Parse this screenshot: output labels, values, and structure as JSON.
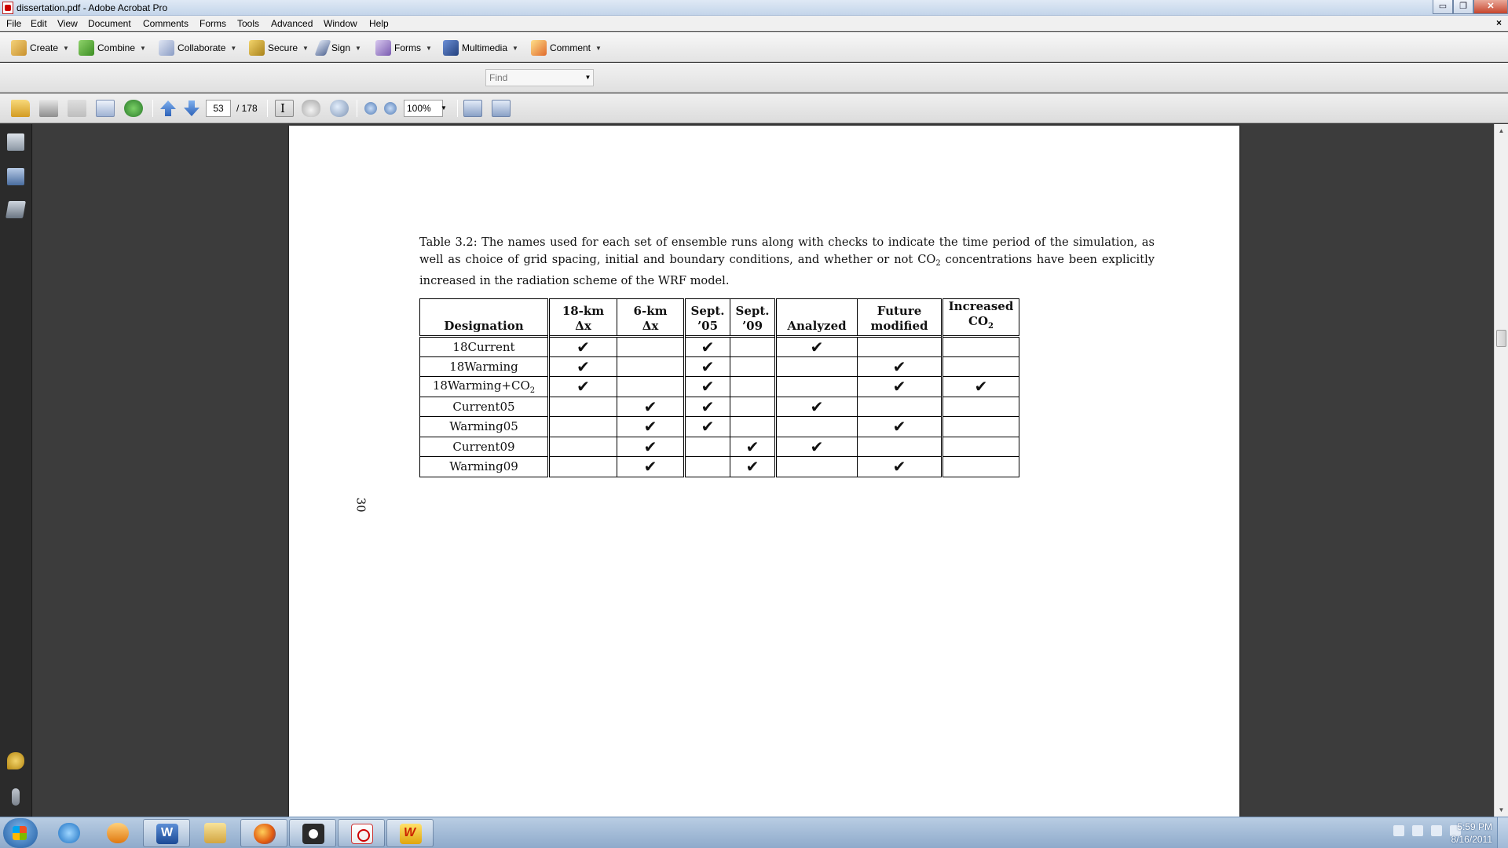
{
  "window": {
    "title": "dissertation.pdf - Adobe Acrobat Pro",
    "buttons": {
      "minimize": "▭",
      "restore": "❐",
      "close": "✕"
    }
  },
  "menu": [
    "File",
    "Edit",
    "View",
    "Document",
    "Comments",
    "Forms",
    "Tools",
    "Advanced",
    "Window",
    "Help"
  ],
  "menu_close": "×",
  "tasks": [
    {
      "label": "Create",
      "icon": "create-icon"
    },
    {
      "label": "Combine",
      "icon": "combine-icon"
    },
    {
      "label": "Collaborate",
      "icon": "collaborate-icon"
    },
    {
      "label": "Secure",
      "icon": "lock-icon"
    },
    {
      "label": "Sign",
      "icon": "pen-icon"
    },
    {
      "label": "Forms",
      "icon": "forms-icon"
    },
    {
      "label": "Multimedia",
      "icon": "multimedia-icon"
    },
    {
      "label": "Comment",
      "icon": "comment-icon"
    }
  ],
  "find": {
    "placeholder": "Find"
  },
  "nav": {
    "page_current": "53",
    "page_total": "/ 178",
    "zoom": "100%"
  },
  "document": {
    "caption_main": "Table 3.2:  The names used for each set of ensemble runs along with checks to indicate the time period of the simulation, as well as choice of grid spacing, initial and boundary conditions, and whether or not CO",
    "caption_sub": "2",
    "caption_tail": " concentrations have been explicitly increased in the radiation scheme of the WRF model.",
    "page_number": "30",
    "table": {
      "headers": {
        "designation": "Designation",
        "grid18_l1": "18-km",
        "grid18_l2": "Δx",
        "grid6_l1": "6-km",
        "grid6_l2": "Δx",
        "sep05_l1": "Sept.",
        "sep05_l2": "’05",
        "sep09_l1": "Sept.",
        "sep09_l2": "’09",
        "analyzed": "Analyzed",
        "future_l1": "Future",
        "future_l2": "modified",
        "co2_l1": "Increased",
        "co2_l2": "CO",
        "co2_sub": "2"
      },
      "check_mark": "✔",
      "rows": [
        {
          "name": "18Current",
          "name_sub": "",
          "km18": true,
          "km6": false,
          "sep05": true,
          "sep09": false,
          "analyzed": true,
          "future": false,
          "co2": false
        },
        {
          "name": "18Warming",
          "name_sub": "",
          "km18": true,
          "km6": false,
          "sep05": true,
          "sep09": false,
          "analyzed": false,
          "future": true,
          "co2": false
        },
        {
          "name": "18Warming+CO",
          "name_sub": "2",
          "km18": true,
          "km6": false,
          "sep05": true,
          "sep09": false,
          "analyzed": false,
          "future": true,
          "co2": true
        },
        {
          "name": "Current05",
          "name_sub": "",
          "km18": false,
          "km6": true,
          "sep05": true,
          "sep09": false,
          "analyzed": true,
          "future": false,
          "co2": false
        },
        {
          "name": "Warming05",
          "name_sub": "",
          "km18": false,
          "km6": true,
          "sep05": true,
          "sep09": false,
          "analyzed": false,
          "future": true,
          "co2": false
        },
        {
          "name": "Current09",
          "name_sub": "",
          "km18": false,
          "km6": true,
          "sep05": false,
          "sep09": true,
          "analyzed": true,
          "future": false,
          "co2": false
        },
        {
          "name": "Warming09",
          "name_sub": "",
          "km18": false,
          "km6": true,
          "sep05": false,
          "sep09": true,
          "analyzed": false,
          "future": true,
          "co2": false
        }
      ]
    }
  },
  "taskbar": {
    "time": "5:59 PM",
    "date": "8/16/2011"
  }
}
